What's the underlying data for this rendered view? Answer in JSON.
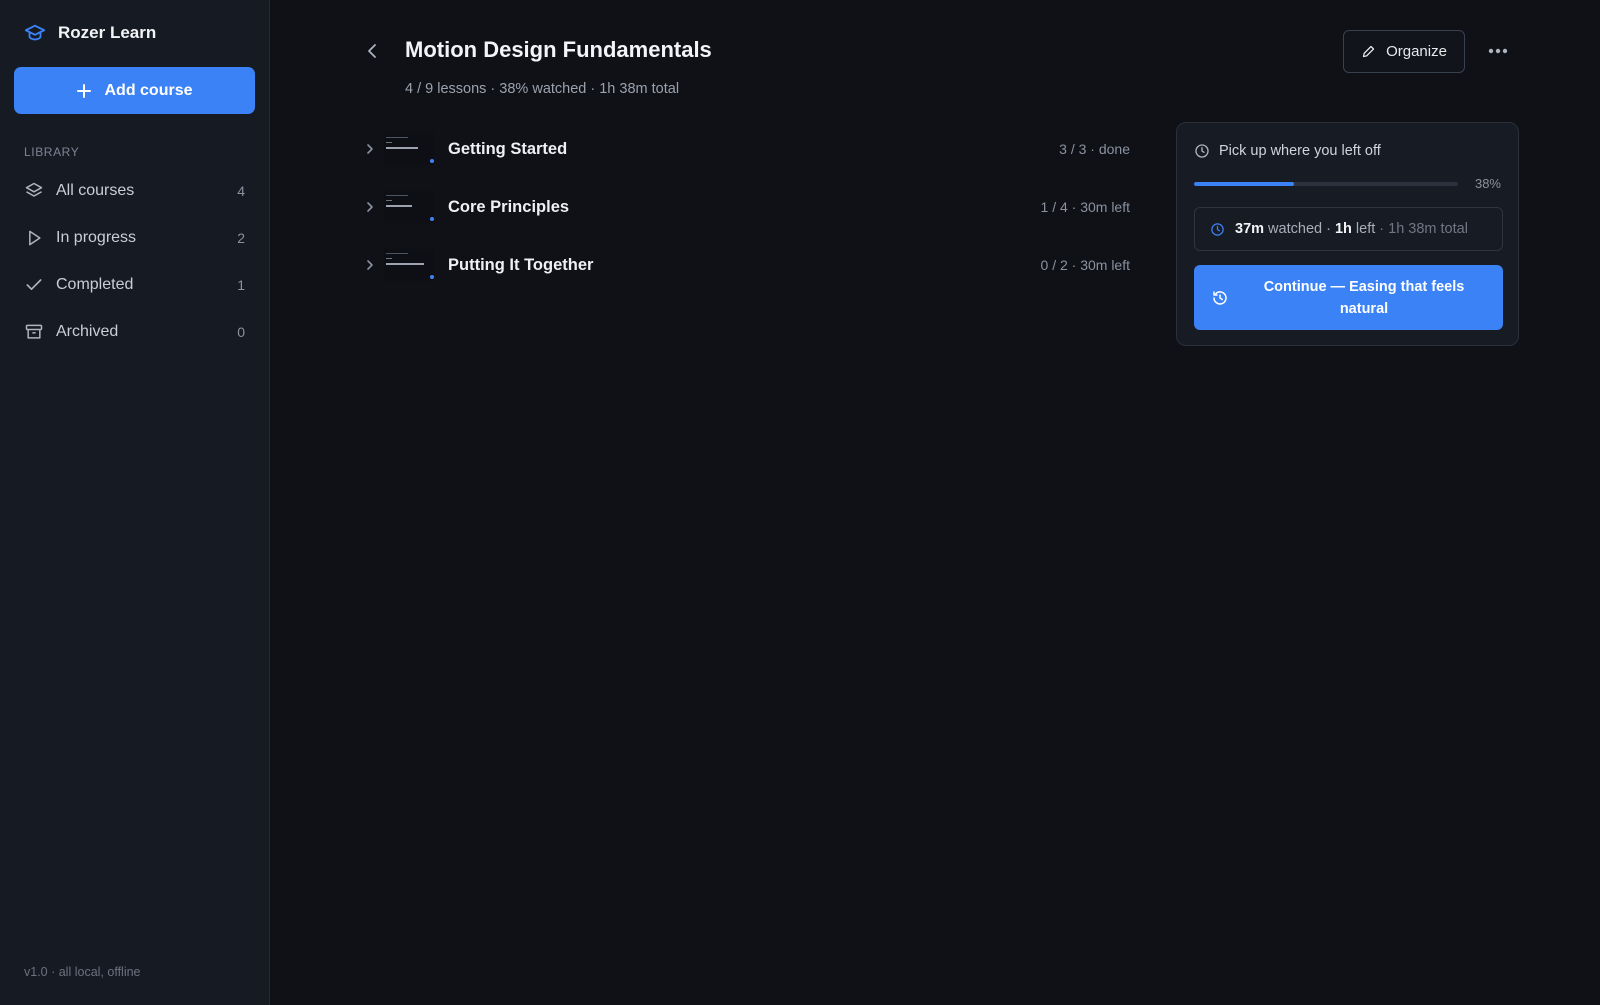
{
  "app": {
    "name": "Rozer Learn",
    "accent": "#3b82f6"
  },
  "sidebar": {
    "add_button": "Add course",
    "section_label": "LIBRARY",
    "items": [
      {
        "label": "All courses",
        "count": "4",
        "icon": "layers-icon"
      },
      {
        "label": "In progress",
        "count": "2",
        "icon": "play-icon"
      },
      {
        "label": "Completed",
        "count": "1",
        "icon": "check-icon"
      },
      {
        "label": "Archived",
        "count": "0",
        "icon": "archive-icon"
      }
    ],
    "footer": "v1.0 · all local, offline"
  },
  "course": {
    "title": "Motion Design Fundamentals",
    "subtitle": "4 / 9 lessons · 38% watched · 1h 38m total",
    "organize_label": "Organize",
    "sections": [
      {
        "title": "Getting Started",
        "meta": "3 / 3 · done"
      },
      {
        "title": "Core Principles",
        "meta": "1 / 4 · 30m left"
      },
      {
        "title": "Putting It Together",
        "meta": "0 / 2 · 30m left"
      }
    ]
  },
  "resume": {
    "heading": "Pick up where you left off",
    "progress_percent": 38,
    "progress_label": "38%",
    "watched": "37m",
    "watched_word": " watched · ",
    "left": "1h",
    "left_word": " left",
    "total": " · 1h 38m total",
    "continue_label": "Continue — Easing that feels natural"
  }
}
